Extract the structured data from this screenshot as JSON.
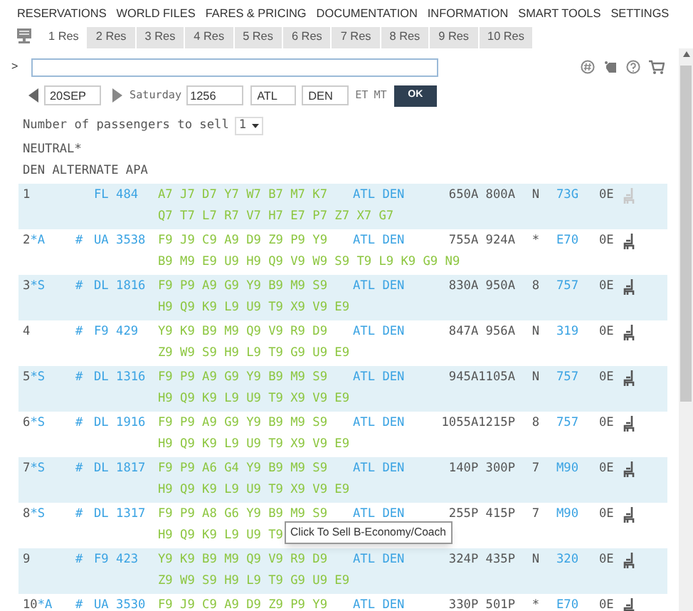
{
  "menu": [
    "RESERVATIONS",
    "WORLD FILES",
    "FARES & PRICING",
    "DOCUMENTATION",
    "INFORMATION",
    "SMART TOOLS",
    "SETTINGS"
  ],
  "tabs": [
    {
      "label": "1 Res",
      "selected": true
    },
    {
      "label": "2 Res",
      "selected": false
    },
    {
      "label": "3 Res",
      "selected": false
    },
    {
      "label": "4 Res",
      "selected": false
    },
    {
      "label": "5 Res",
      "selected": false
    },
    {
      "label": "6 Res",
      "selected": false
    },
    {
      "label": "7 Res",
      "selected": false
    },
    {
      "label": "8 Res",
      "selected": false
    },
    {
      "label": "9 Res",
      "selected": false
    },
    {
      "label": "10 Res",
      "selected": false
    }
  ],
  "command": {
    "prompt": ">"
  },
  "search": {
    "date": "20SEP",
    "day": "Saturday",
    "time": "1256",
    "from": "ATL",
    "to": "DEN",
    "from_zone": "ET",
    "to_zone": "MT",
    "button": "OK"
  },
  "passengers": {
    "label": "Number of passengers to sell",
    "value": "1"
  },
  "header": [
    "NEUTRAL*",
    "DEN ALTERNATE APA"
  ],
  "rows": [
    {
      "num": "1",
      "suffix": "",
      "mark": "",
      "flight": "FL 484",
      "classes": "A7 J7 D7 Y7 W7 B7 M7 K7",
      "classes2": "Q7 T7 L7 R7 V7 H7 E7 P7 Z7 X7 G7",
      "route": "ATL DEN",
      "times": "650A 800A",
      "meal": "N",
      "equip": "73G",
      "stops": "0E",
      "seat_enabled": false
    },
    {
      "num": "2",
      "suffix": "*A",
      "mark": "#",
      "flight": "UA 3538",
      "classes": "F9 J9 C9 A9 D9 Z9 P9 Y9",
      "classes2": "B9 M9 E9 U9 H9 Q9 V9 W9 S9 T9 L9 K9 G9 N9",
      "route": "ATL DEN",
      "times": "755A 924A",
      "meal": "*",
      "equip": "E70",
      "stops": "0E",
      "seat_enabled": true
    },
    {
      "num": "3",
      "suffix": "*S",
      "mark": "#",
      "flight": "DL 1816",
      "classes": "F9 P9 A9 G9 Y9 B9 M9 S9",
      "classes2": "H9 Q9 K9 L9 U9 T9 X9 V9 E9",
      "route": "ATL DEN",
      "times": "830A 950A",
      "meal": "8",
      "equip": "757",
      "stops": "0E",
      "seat_enabled": true
    },
    {
      "num": "4",
      "suffix": "",
      "mark": "#",
      "flight": "F9 429",
      "classes": "Y9 K9 B9 M9 Q9 V9 R9 D9",
      "classes2": "Z9 W9 S9 H9 L9 T9 G9 U9 E9",
      "route": "ATL DEN",
      "times": "847A 956A",
      "meal": "N",
      "equip": "319",
      "stops": "0E",
      "seat_enabled": true
    },
    {
      "num": "5",
      "suffix": "*S",
      "mark": "#",
      "flight": "DL 1316",
      "classes": "F9 P9 A9 G9 Y9 B9 M9 S9",
      "classes2": "H9 Q9 K9 L9 U9 T9 X9 V9 E9",
      "route": "ATL DEN",
      "times": "945A1105A",
      "meal": "N",
      "equip": "757",
      "stops": "0E",
      "seat_enabled": true
    },
    {
      "num": "6",
      "suffix": "*S",
      "mark": "#",
      "flight": "DL 1916",
      "classes": "F9 P9 A9 G9 Y9 B9 M9 S9",
      "classes2": "H9 Q9 K9 L9 U9 T9 X9 V9 E9",
      "route": "ATL DEN",
      "times": "1055A1215P",
      "meal": "8",
      "equip": "757",
      "stops": "0E",
      "seat_enabled": true
    },
    {
      "num": "7",
      "suffix": "*S",
      "mark": "#",
      "flight": "DL 1817",
      "classes": "F9 P9 A6 G4 Y9 B9 M9 S9",
      "classes2": "H9 Q9 K9 L9 U9 T9 X9 V9 E9",
      "route": "ATL DEN",
      "times": "140P 300P",
      "meal": "7",
      "equip": "M90",
      "stops": "0E",
      "seat_enabled": true
    },
    {
      "num": "8",
      "suffix": "*S",
      "mark": "#",
      "flight": "DL 1317",
      "classes": "F9 P9 A8 G6 Y9 B9 M9 S9",
      "classes2": "H9 Q9 K9 L9 U9 T9",
      "route": "ATL DEN",
      "times": "255P 415P",
      "meal": "7",
      "equip": "M90",
      "stops": "0E",
      "seat_enabled": true,
      "tooltip": "Click To Sell B-Economy/Coach"
    },
    {
      "num": "9",
      "suffix": "",
      "mark": "#",
      "flight": "F9 423",
      "classes": "Y9 K9 B9 M9 Q9 V9 R9 D9",
      "classes2": "Z9 W9 S9 H9 L9 T9 G9 U9 E9",
      "route": "ATL DEN",
      "times": "324P 435P",
      "meal": "N",
      "equip": "320",
      "stops": "0E",
      "seat_enabled": true
    },
    {
      "num": "10",
      "suffix": "*A",
      "mark": "#",
      "flight": "UA 3530",
      "classes": "F9 J9 C9 A9 D9 Z9 P9 Y9",
      "route": "ATL DEN",
      "times": "330P 501P",
      "meal": "*",
      "equip": "E70",
      "stops": "0E",
      "seat_enabled": true
    }
  ]
}
